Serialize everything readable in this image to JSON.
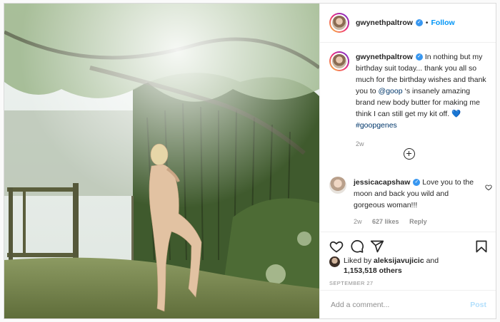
{
  "post": {
    "author": "gwynethpaltrow",
    "follow_label": "Follow",
    "separator": "•",
    "caption": {
      "author": "gwynethpaltrow",
      "text_before_mention": " In nothing but my birthday suit today... thank you all so much for the birthday wishes and thank you to ",
      "mention": "@goop",
      "text_after_mention": " ‘s insanely amazing brand new body butter for making me think I can still get my kit off. 💙 ",
      "hashtag": "#goopgenes",
      "time": "2w"
    },
    "comments": [
      {
        "author": "jessicacapshaw",
        "text": " Love you to the moon and back you wild and gorgeous woman!!!",
        "time": "2w",
        "likes": "627 likes",
        "reply_label": "Reply"
      }
    ],
    "liked_by_prefix": "Liked by ",
    "liked_by_user": "aleksijavujicic",
    "liked_by_and": " and",
    "likes_count": "1,153,518 others",
    "date": "SEPTEMBER 27",
    "add_comment_placeholder": "Add a comment...",
    "post_label": "Post"
  },
  "icons": [
    "verified-icon",
    "heart-icon",
    "comment-icon",
    "share-icon",
    "bookmark-icon",
    "add-more-icon"
  ],
  "colors": {
    "link_blue": "#0095f6",
    "verified_blue": "#3897f0",
    "post_disabled": "#b2dffc",
    "muted": "#8e8e8e"
  }
}
